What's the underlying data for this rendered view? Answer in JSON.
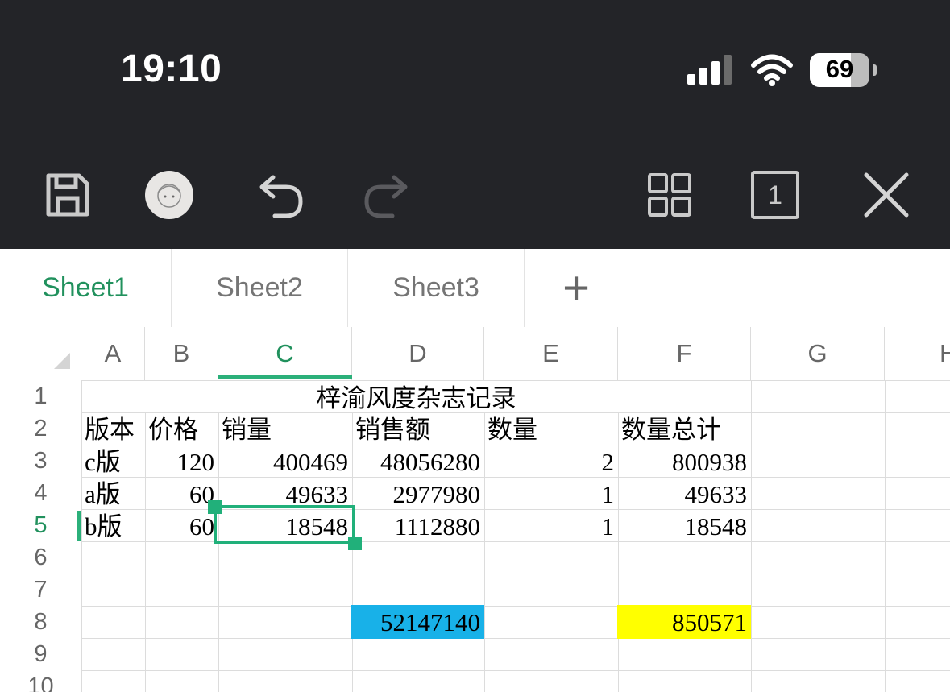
{
  "status_bar": {
    "time": "19:10",
    "battery": "69",
    "battery_level": 0.69
  },
  "toolbar": {
    "save_icon": "save-icon",
    "avatar_icon": "avatar-icon",
    "undo_icon": "undo-icon",
    "redo_icon": "redo-icon",
    "grid_icon": "grid-view-icon",
    "page_count": "1",
    "close_icon": "close-icon"
  },
  "sheets": {
    "tab1": "Sheet1",
    "tab2": "Sheet2",
    "tab3": "Sheet3",
    "add": "+"
  },
  "columns": {
    "A": "A",
    "B": "B",
    "C": "C",
    "D": "D",
    "E": "E",
    "F": "F",
    "G": "G",
    "H": "H"
  },
  "rows": {
    "r1": "1",
    "r2": "2",
    "r3": "3",
    "r4": "4",
    "r5": "5",
    "r6": "6",
    "r7": "7",
    "r8": "8",
    "r9": "9",
    "r10": "10"
  },
  "cells": {
    "title": "梓渝风度杂志记录",
    "headers": {
      "a": "版本",
      "b": "价格",
      "c": "销量",
      "d": "销售额",
      "e": "数量",
      "f": "数量总计"
    },
    "row3": {
      "a": "c版",
      "b": "120",
      "c": "400469",
      "d": "48056280",
      "e": "2",
      "f": "800938"
    },
    "row4": {
      "a": "a版",
      "b": "60",
      "c": "49633",
      "d": "2977980",
      "e": "1",
      "f": "49633"
    },
    "row5": {
      "a": "b版",
      "b": "60",
      "c": "18548",
      "d": "1112880",
      "e": "1",
      "f": "18548"
    },
    "total_sales": "52147140",
    "total_quantity": "850571"
  },
  "colors": {
    "accent": "#21915d",
    "total_sales_bg": "#18b1e8",
    "total_quantity_bg": "#ffff00",
    "toolbar_bg": "#232428"
  }
}
